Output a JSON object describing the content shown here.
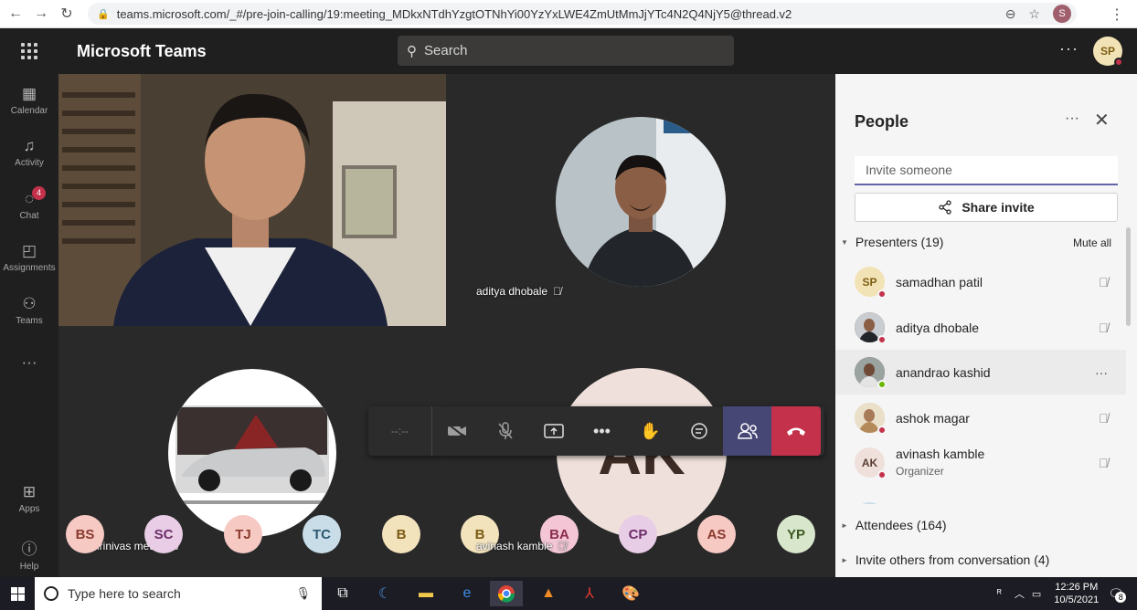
{
  "browser": {
    "url": "teams.microsoft.com/_#/pre-join-calling/19:meeting_MDkxNTdhYzgtOTNhYi00YzYxLWE4ZmUtMmJjYTc4N2Q4NjY5@thread.v2",
    "profile_initial": "S"
  },
  "header": {
    "app_title": "Microsoft Teams",
    "search_placeholder": "Search",
    "me_initials": "SP"
  },
  "rail": [
    {
      "label": "Calendar"
    },
    {
      "label": "Activity"
    },
    {
      "label": "Chat",
      "badge": "4"
    },
    {
      "label": "Assignments"
    },
    {
      "label": "Teams"
    },
    {
      "label": "Apps"
    },
    {
      "label": "Help"
    }
  ],
  "stage": {
    "tiles": [
      {
        "name": "aditya dhobale"
      },
      {
        "name": "shrinivas metan"
      },
      {
        "name": "avinash kamble",
        "initials": "AK"
      }
    ],
    "call_bar": {
      "timer": "--:--"
    },
    "avatar_row": [
      {
        "initials": "BS",
        "bg": "#f6c9c3",
        "fg": "#8a3a2e"
      },
      {
        "initials": "SC",
        "bg": "#e9cde6",
        "fg": "#6b2e68"
      },
      {
        "initials": "TJ",
        "bg": "#f6c9c3",
        "fg": "#8a3a2e"
      },
      {
        "initials": "TC",
        "bg": "#c9dde8",
        "fg": "#2c5770"
      },
      {
        "initials": "B",
        "bg": "#f3e3bd",
        "fg": "#7a5a12"
      },
      {
        "initials": "B",
        "bg": "#f3e3bd",
        "fg": "#7a5a12"
      },
      {
        "initials": "BA",
        "bg": "#f3c5d5",
        "fg": "#8a2d4a"
      },
      {
        "initials": "CP",
        "bg": "#e8cde6",
        "fg": "#6b2e68"
      },
      {
        "initials": "AS",
        "bg": "#f6c9c3",
        "fg": "#8a3a2e"
      },
      {
        "initials": "YP",
        "bg": "#d8e6cc",
        "fg": "#3d5a24"
      }
    ]
  },
  "people_panel": {
    "title": "People",
    "invite_placeholder": "Invite someone",
    "share_label": "Share invite",
    "presenters_label": "Presenters (19)",
    "mute_all": "Mute all",
    "presenters": [
      {
        "name": "samadhan patil",
        "initials": "SP",
        "status": "busy"
      },
      {
        "name": "aditya dhobale",
        "initials": "",
        "status": "busy"
      },
      {
        "name": "anandrao kashid",
        "initials": "",
        "status": "available"
      },
      {
        "name": "ashok magar",
        "initials": "",
        "status": "busy"
      },
      {
        "name": "avinash kamble",
        "initials": "AK",
        "role": "Organizer",
        "status": "busy"
      }
    ],
    "attendees_label": "Attendees (164)",
    "invite_others_label": "Invite others from conversation (4)"
  },
  "taskbar": {
    "search_placeholder": "Type here to search",
    "time": "12:26 PM",
    "date": "10/5/2021",
    "notification_count": "8"
  }
}
